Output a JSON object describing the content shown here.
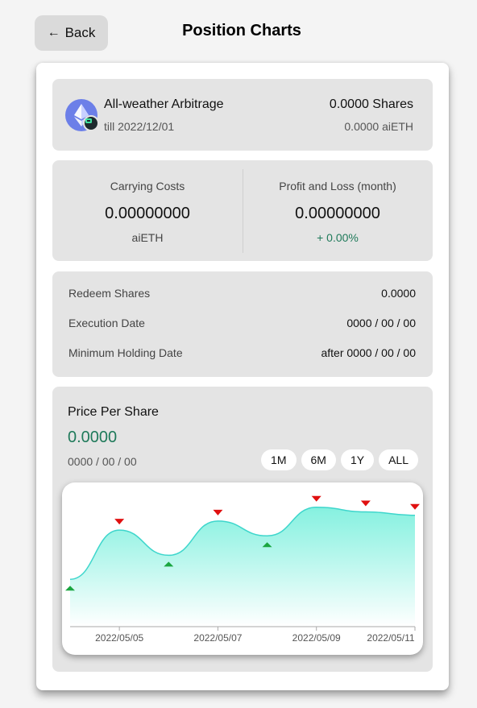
{
  "header": {
    "back_label": "Back",
    "title": "Position Charts"
  },
  "product": {
    "name": "All-weather Arbitrage",
    "till": "till 2022/12/01",
    "shares": "0.0000 Shares",
    "amount": "0.0000 aiETH"
  },
  "costs": {
    "carrying_label": "Carrying Costs",
    "carrying_value": "0.00000000",
    "carrying_unit": "aiETH",
    "pnl_label": "Profit and Loss (month)",
    "pnl_value": "0.00000000",
    "pnl_change": "+ 0.00%"
  },
  "details": {
    "rows": [
      {
        "label": "Redeem Shares",
        "value": "0.0000"
      },
      {
        "label": "Execution Date",
        "value": "0000 / 00 / 00"
      },
      {
        "label": "Minimum Holding Date",
        "value": "after 0000 / 00 / 00"
      }
    ]
  },
  "price": {
    "title": "Price Per Share",
    "value": "0.0000",
    "date": "0000 / 00 / 00",
    "ranges": [
      "1M",
      "6M",
      "1Y",
      "ALL"
    ]
  },
  "colors": {
    "accent_green": "#1f7a5a",
    "buy_marker": "#1aa640",
    "sell_marker": "#e01010",
    "line": "#3ed6cc"
  },
  "chart_data": {
    "type": "area",
    "x": [
      "2022/05/04",
      "2022/05/05",
      "2022/05/06",
      "2022/05/07",
      "2022/05/08",
      "2022/05/09",
      "2022/05/10",
      "2022/05/11"
    ],
    "values": [
      0.28,
      0.71,
      0.49,
      0.79,
      0.66,
      0.91,
      0.87,
      0.84
    ],
    "xticks": [
      "2022/05/05",
      "2022/05/07",
      "2022/05/09",
      "2022/05/11"
    ],
    "markers": [
      {
        "x": "2022/05/04",
        "kind": "buy"
      },
      {
        "x": "2022/05/05",
        "kind": "sell"
      },
      {
        "x": "2022/05/06",
        "kind": "buy"
      },
      {
        "x": "2022/05/07",
        "kind": "sell"
      },
      {
        "x": "2022/05/08",
        "kind": "buy"
      },
      {
        "x": "2022/05/09",
        "kind": "sell"
      },
      {
        "x": "2022/05/10",
        "kind": "sell"
      },
      {
        "x": "2022/05/11",
        "kind": "sell"
      }
    ],
    "ylim": [
      0,
      1
    ],
    "grid": false
  }
}
